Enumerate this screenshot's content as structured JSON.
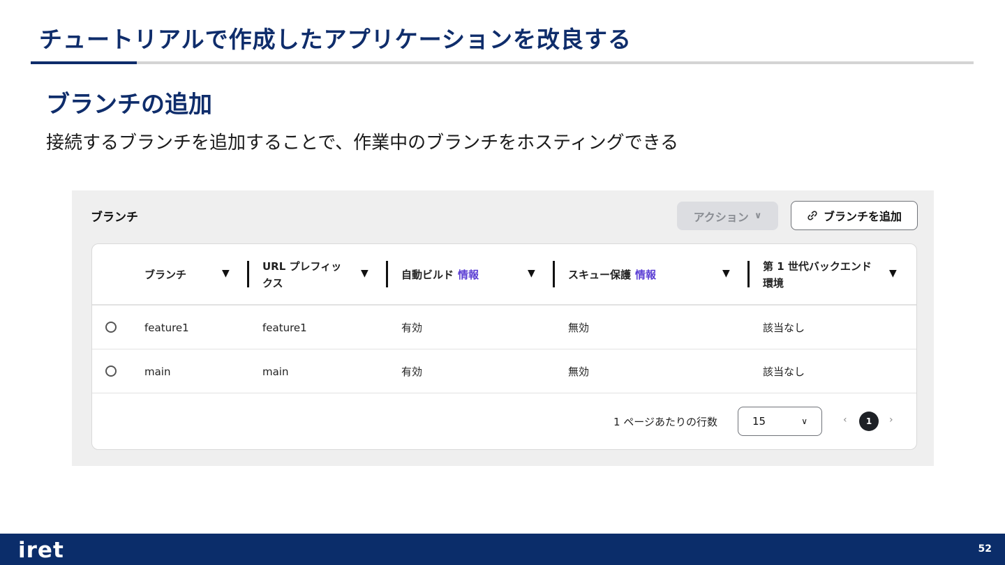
{
  "slide": {
    "title": "チュートリアルで作成したアプリケーションを改良する",
    "section_heading": "ブランチの追加",
    "description": "接続するブランチを追加することで、作業中のブランチをホスティングできる"
  },
  "panel": {
    "title": "ブランチ",
    "actions_label": "アクション",
    "add_branch_label": "ブランチを追加"
  },
  "table": {
    "headers": {
      "branch": "ブランチ",
      "url_prefix": "URL プレフィックス",
      "auto_build": "自動ビルド",
      "skew_protection": "スキュー保護",
      "gen1_backend": "第 1 世代バックエンド環境",
      "info": "情報"
    },
    "rows": [
      {
        "branch": "feature1",
        "url_prefix": "feature1",
        "auto_build": "有効",
        "skew_protection": "無効",
        "gen1_backend": "該当なし"
      },
      {
        "branch": "main",
        "url_prefix": "main",
        "auto_build": "有効",
        "skew_protection": "無効",
        "gen1_backend": "該当なし"
      }
    ]
  },
  "pagination": {
    "rows_per_page_label": "1 ページあたりの行数",
    "rows_per_page": "15",
    "current_page": "1"
  },
  "footer": {
    "logo": "iret",
    "page_number": "52"
  }
}
